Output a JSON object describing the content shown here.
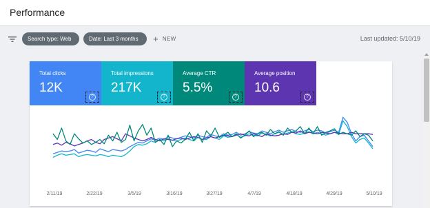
{
  "header": {
    "title": "Performance"
  },
  "toolbar": {
    "filter_icon": "filter-list-icon",
    "chips": [
      {
        "label": "Search type: Web",
        "icon": "pencil-icon"
      },
      {
        "label": "Date: Last 3 months",
        "icon": "pencil-icon"
      }
    ],
    "new_label": "NEW",
    "last_updated": "Last updated: 5/10/19"
  },
  "metrics": [
    {
      "label": "Total clicks",
      "value": "12K",
      "color": "#4285f4"
    },
    {
      "label": "Total impressions",
      "value": "217K",
      "color": "#12b5cb"
    },
    {
      "label": "Average CTR",
      "value": "5.5%",
      "color": "#00897b"
    },
    {
      "label": "Average position",
      "value": "10.6",
      "color": "#5e35b1"
    }
  ],
  "chart_data": {
    "type": "line",
    "x_ticks": [
      "2/11/19",
      "2/22/19",
      "3/5/19",
      "3/16/19",
      "3/27/19",
      "4/7/19",
      "4/18/19",
      "4/29/19",
      "5/10/19"
    ],
    "grid": false,
    "series": [
      {
        "metric": "clicks",
        "color": "#4285f4",
        "values": [
          0.42,
          0.44,
          0.46,
          0.45,
          0.46,
          0.48,
          0.43,
          0.45,
          0.47,
          0.46,
          0.44,
          0.49,
          0.47,
          0.45,
          0.48,
          0.47,
          0.46,
          0.48,
          0.52,
          0.55,
          0.58,
          0.57,
          0.6,
          0.63,
          0.61,
          0.64,
          0.62,
          0.66,
          0.64,
          0.63,
          0.65,
          0.67,
          0.66,
          0.64,
          0.68,
          0.66,
          0.65,
          0.69,
          0.67,
          0.66,
          0.7,
          0.68,
          0.69,
          0.72,
          0.68,
          0.7,
          0.73,
          0.71,
          0.7,
          0.74,
          0.72,
          0.7,
          0.73,
          0.75,
          0.72,
          0.74,
          0.76,
          0.73,
          0.72,
          0.74,
          0.76,
          0.73,
          0.75,
          0.74,
          0.71,
          0.73,
          0.75,
          0.72,
          0.93,
          0.86,
          0.7,
          0.6,
          0.66,
          0.68,
          0.6,
          0.52
        ]
      },
      {
        "metric": "impressions",
        "color": "#12b5cb",
        "values": [
          0.37,
          0.4,
          0.42,
          0.4,
          0.41,
          0.42,
          0.38,
          0.4,
          0.41,
          0.4,
          0.39,
          0.41,
          0.4,
          0.38,
          0.4,
          0.39,
          0.38,
          0.41,
          0.46,
          0.52,
          0.55,
          0.54,
          0.56,
          0.6,
          0.58,
          0.62,
          0.6,
          0.63,
          0.61,
          0.6,
          0.62,
          0.64,
          0.62,
          0.6,
          0.65,
          0.62,
          0.62,
          0.66,
          0.64,
          0.62,
          0.67,
          0.65,
          0.66,
          0.69,
          0.65,
          0.67,
          0.7,
          0.68,
          0.67,
          0.71,
          0.69,
          0.67,
          0.7,
          0.72,
          0.69,
          0.71,
          0.73,
          0.7,
          0.69,
          0.71,
          0.73,
          0.7,
          0.72,
          0.7,
          0.68,
          0.7,
          0.72,
          0.69,
          0.88,
          0.8,
          0.66,
          0.57,
          0.62,
          0.64,
          0.57,
          0.49
        ]
      },
      {
        "metric": "ctr",
        "color": "#00897b",
        "values": [
          0.7,
          0.62,
          0.78,
          0.6,
          0.55,
          0.7,
          0.63,
          0.57,
          0.6,
          0.55,
          0.58,
          0.62,
          0.56,
          0.68,
          0.6,
          0.72,
          0.58,
          0.62,
          0.82,
          0.6,
          0.74,
          0.83,
          0.68,
          0.78,
          0.58,
          0.62,
          0.55,
          0.68,
          0.52,
          0.6,
          0.57,
          0.62,
          0.72,
          0.6,
          0.7,
          0.58,
          0.74,
          0.67,
          0.78,
          0.65,
          0.68,
          0.72,
          0.66,
          0.7,
          0.64,
          0.68,
          0.74,
          0.66,
          0.7,
          0.72,
          0.68,
          0.76,
          0.7,
          0.73,
          0.68,
          0.78,
          0.72,
          0.74,
          0.8,
          0.7,
          0.78,
          0.7,
          0.8,
          0.68,
          0.72,
          0.74,
          0.77,
          0.69,
          0.72,
          0.7,
          0.68,
          0.74,
          0.66,
          0.7,
          0.68,
          0.6
        ]
      },
      {
        "metric": "position",
        "color": "#5e35b1",
        "values": [
          0.55,
          0.57,
          0.54,
          0.58,
          0.56,
          0.53,
          0.55,
          0.57,
          0.6,
          0.62,
          0.58,
          0.56,
          0.62,
          0.64,
          0.66,
          0.63,
          0.6,
          0.7,
          0.67,
          0.64,
          0.62,
          0.6,
          0.62,
          0.65,
          0.62,
          0.6,
          0.63,
          0.62,
          0.61,
          0.63,
          0.64,
          0.62,
          0.64,
          0.66,
          0.65,
          0.62,
          0.64,
          0.66,
          0.64,
          0.66,
          0.68,
          0.67,
          0.66,
          0.68,
          0.7,
          0.68,
          0.67,
          0.7,
          0.68,
          0.66,
          0.7,
          0.68,
          0.67,
          0.68,
          0.7,
          0.69,
          0.72,
          0.71,
          0.74,
          0.7,
          0.72,
          0.71,
          0.7,
          0.72,
          0.71,
          0.7,
          0.72,
          0.71,
          0.7,
          0.7,
          0.72,
          0.7,
          0.7,
          0.7,
          0.7,
          0.69
        ]
      }
    ]
  }
}
